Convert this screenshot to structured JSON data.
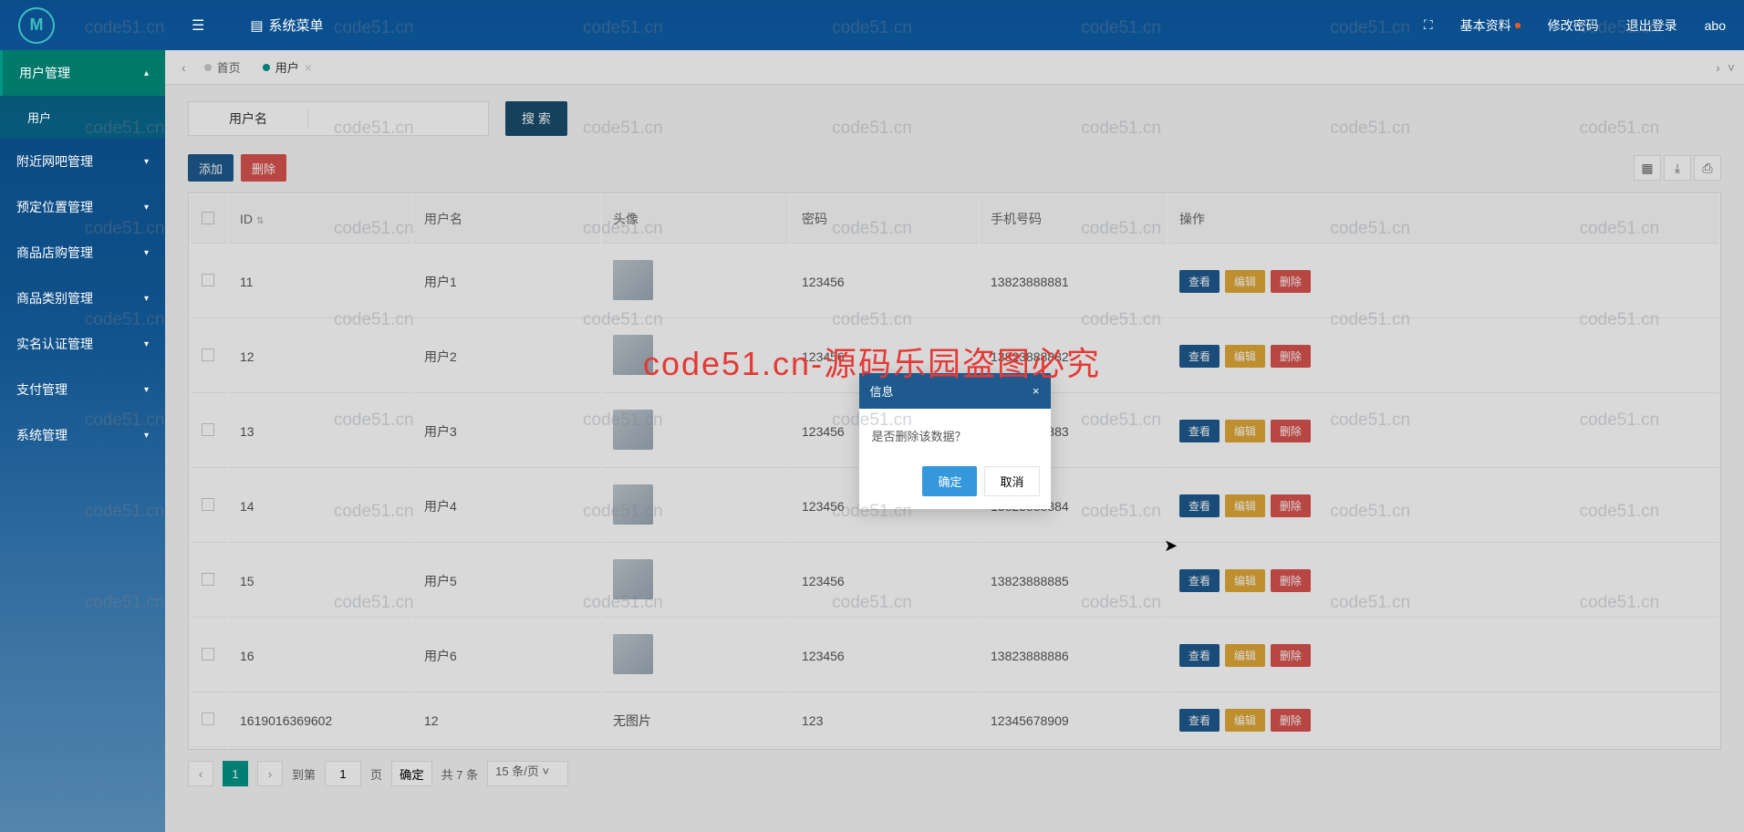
{
  "header": {
    "system_menu": "系统菜单",
    "fullscreen_icon": "⛶",
    "basic_info": "基本资料",
    "change_pwd": "修改密码",
    "logout": "退出登录",
    "username": "abo"
  },
  "sidebar": {
    "items": [
      {
        "label": "用户管理",
        "expanded": true
      },
      {
        "label": "附近网吧管理",
        "expanded": false
      },
      {
        "label": "预定位置管理",
        "expanded": false
      },
      {
        "label": "商品店购管理",
        "expanded": false
      },
      {
        "label": "商品类别管理",
        "expanded": false
      },
      {
        "label": "实名认证管理",
        "expanded": false
      },
      {
        "label": "支付管理",
        "expanded": false
      },
      {
        "label": "系统管理",
        "expanded": false
      }
    ],
    "sub_user": "用户"
  },
  "tabs": {
    "home": "首页",
    "user": "用户"
  },
  "search": {
    "label": "用户名",
    "button": "搜 索"
  },
  "toolbar": {
    "add": "添加",
    "delete": "删除"
  },
  "table": {
    "columns": {
      "id": "ID",
      "username": "用户名",
      "avatar": "头像",
      "password": "密码",
      "phone": "手机号码",
      "action": "操作"
    },
    "no_image": "无图片",
    "actions": {
      "view": "查看",
      "edit": "编辑",
      "delete": "删除"
    },
    "rows": [
      {
        "id": "11",
        "username": "用户1",
        "password": "123456",
        "phone": "13823888881",
        "has_avatar": true
      },
      {
        "id": "12",
        "username": "用户2",
        "password": "123456",
        "phone": "13823888882",
        "has_avatar": true
      },
      {
        "id": "13",
        "username": "用户3",
        "password": "123456",
        "phone": "13823888883",
        "has_avatar": true
      },
      {
        "id": "14",
        "username": "用户4",
        "password": "123456",
        "phone": "13823888884",
        "has_avatar": true
      },
      {
        "id": "15",
        "username": "用户5",
        "password": "123456",
        "phone": "13823888885",
        "has_avatar": true
      },
      {
        "id": "16",
        "username": "用户6",
        "password": "123456",
        "phone": "13823888886",
        "has_avatar": true
      },
      {
        "id": "1619016369602",
        "username": "12",
        "password": "123",
        "phone": "12345678909",
        "has_avatar": false
      }
    ]
  },
  "pager": {
    "current": "1",
    "goto_label": "到第",
    "page_suffix": "页",
    "goto_value": "1",
    "confirm": "确定",
    "total": "共 7 条",
    "per_page": "15 条/页"
  },
  "modal": {
    "title": "信息",
    "message": "是否删除该数据？",
    "ok": "确定",
    "cancel": "取消"
  },
  "watermark": {
    "small": "code51.cn",
    "big": "code51.cn-源码乐园盗图必究"
  }
}
